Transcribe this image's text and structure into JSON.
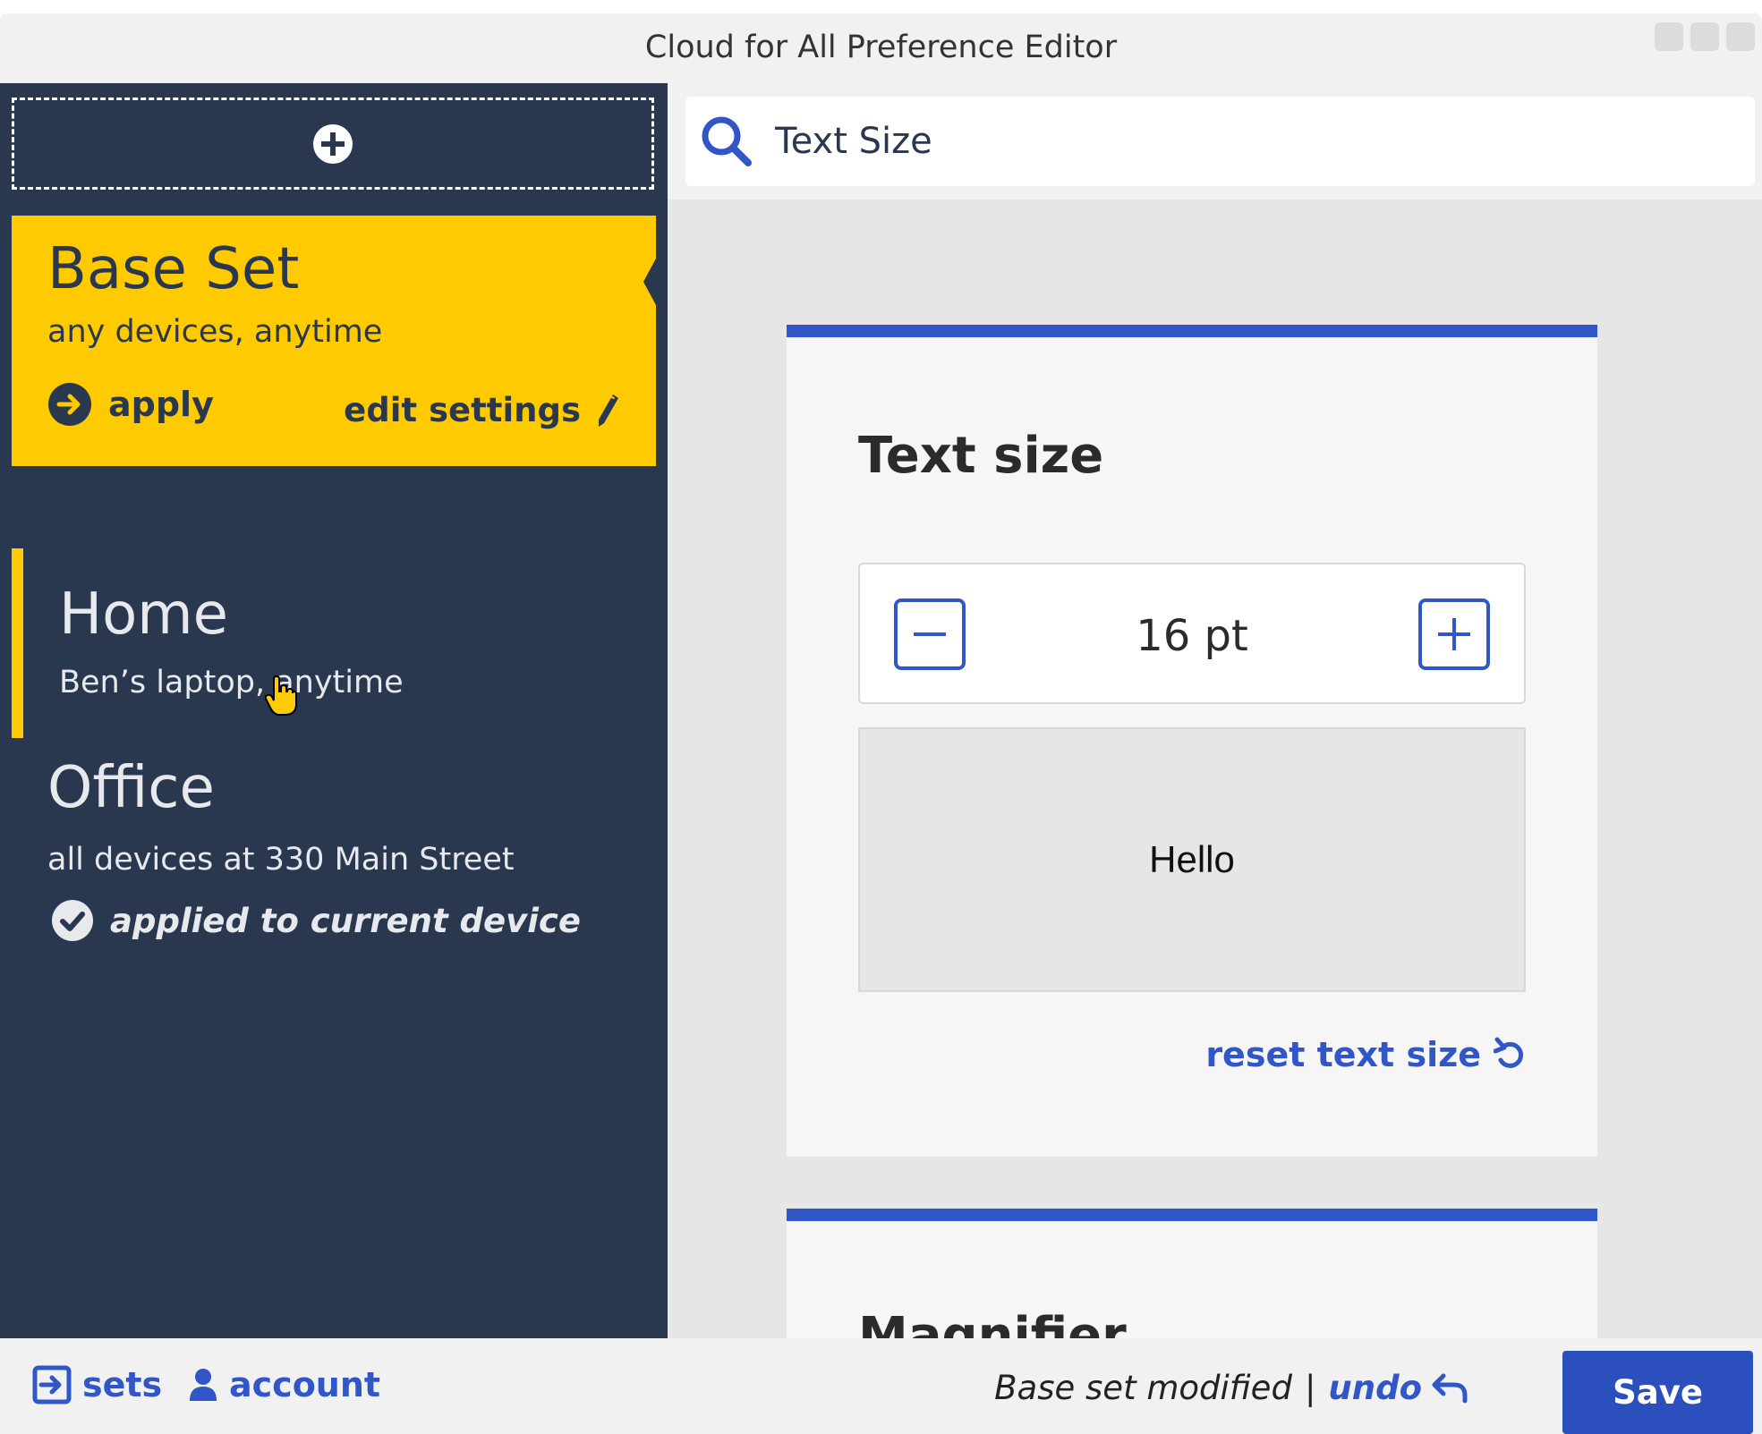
{
  "window": {
    "title": "Cloud for All Preference Editor"
  },
  "sidebar": {
    "add_set_icon": "plus-circle-icon",
    "sets": [
      {
        "name": "Base Set",
        "description": "any devices, anytime",
        "apply_label": "apply",
        "edit_label": "edit settings",
        "selected": true
      },
      {
        "name": "Home",
        "description": "Ben’s laptop, anytime"
      },
      {
        "name": "Office",
        "description": "all devices at 330 Main Street",
        "status_label": "applied to current device"
      }
    ]
  },
  "search": {
    "value": "Text Size",
    "placeholder": ""
  },
  "panels": {
    "text_size": {
      "title": "Text size",
      "value": "16 pt",
      "preview_text": "Hello",
      "reset_label": "reset text size"
    },
    "magnifier": {
      "title": "Magnifier"
    }
  },
  "footer": {
    "sets_label": "sets",
    "account_label": "account",
    "status_text": "Base set modified",
    "separator": "|",
    "undo_label": "undo",
    "save_label": "Save"
  },
  "colors": {
    "sidebar_bg": "#29374f",
    "accent_yellow": "#ffcb00",
    "accent_blue": "#3056c7"
  }
}
